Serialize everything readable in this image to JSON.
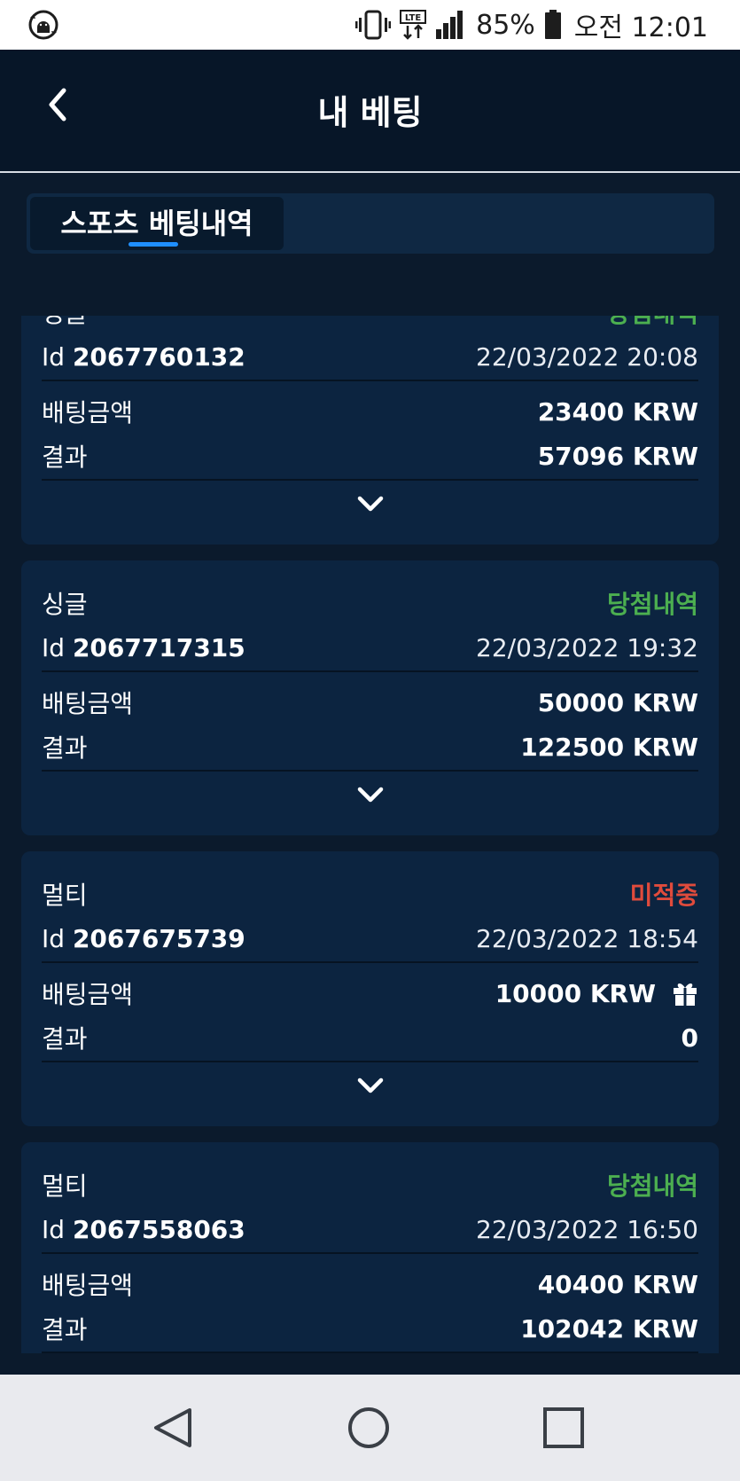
{
  "status_bar": {
    "network": "LTE",
    "battery": "85%",
    "time": "오전 12:01"
  },
  "header": {
    "title": "내 베팅"
  },
  "tabs": [
    {
      "label": "스포츠 베팅내역",
      "active": true
    }
  ],
  "labels": {
    "id_prefix": "Id",
    "amount": "배팅금액",
    "result": "결과"
  },
  "bets": [
    {
      "type": "싱글",
      "status": "당첨내역",
      "status_color": "#4caf50",
      "id": "2067760132",
      "datetime": "22/03/2022 20:08",
      "amount": "23400 KRW",
      "result": "57096 KRW",
      "has_gift": false
    },
    {
      "type": "싱글",
      "status": "당첨내역",
      "status_color": "#4caf50",
      "id": "2067717315",
      "datetime": "22/03/2022 19:32",
      "amount": "50000 KRW",
      "result": "122500 KRW",
      "has_gift": false
    },
    {
      "type": "멀티",
      "status": "미적중",
      "status_color": "#e04b3c",
      "id": "2067675739",
      "datetime": "22/03/2022 18:54",
      "amount": "10000 KRW",
      "result": "0",
      "has_gift": true
    },
    {
      "type": "멀티",
      "status": "당첨내역",
      "status_color": "#4caf50",
      "id": "2067558063",
      "datetime": "22/03/2022 16:50",
      "amount": "40400 KRW",
      "result": "102042 KRW",
      "has_gift": false
    }
  ],
  "icons": {
    "status_left": "android-sync-icon",
    "vibrate": "vibrate-icon",
    "signal": "signal-icon",
    "battery": "battery-icon",
    "back": "chevron-left-icon",
    "expand": "chevron-down-icon",
    "gift": "gift-icon",
    "nav_back": "triangle-back-icon",
    "nav_home": "circle-home-icon",
    "nav_recent": "square-recent-icon"
  },
  "colors": {
    "background": "#0b1a2c",
    "header": "#071628",
    "card": "#0c2440",
    "accent": "#1f8fff",
    "win": "#4caf50",
    "lose": "#e04b3c"
  }
}
